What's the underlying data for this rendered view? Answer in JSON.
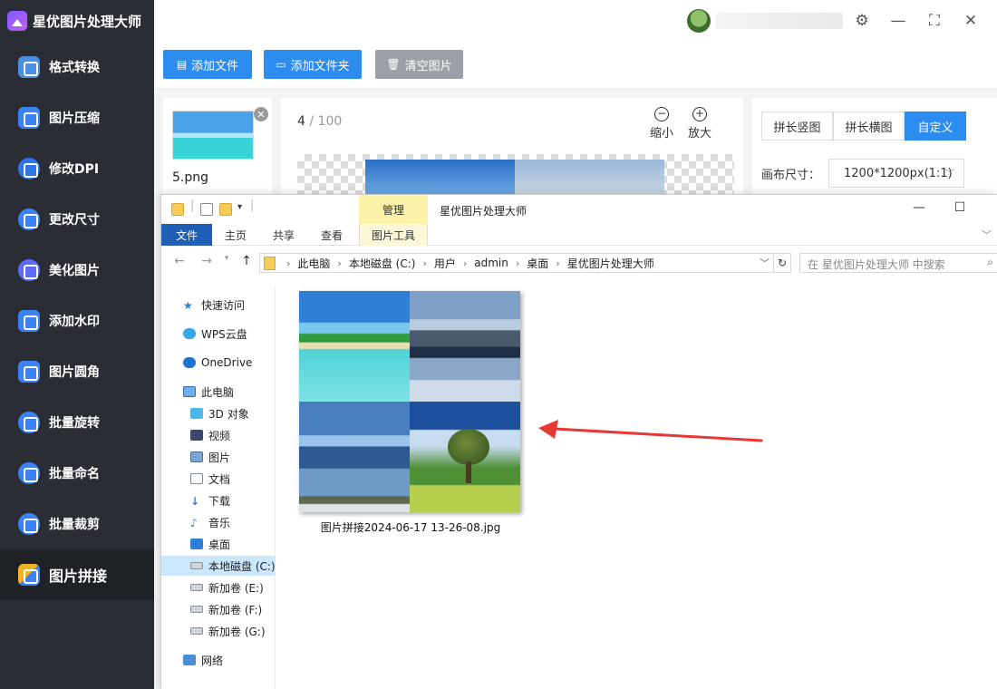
{
  "app": {
    "title": "星优图片处理大师",
    "nav": [
      {
        "label": "格式转换",
        "icon": "format-convert-icon",
        "color": "#4a90e2"
      },
      {
        "label": "图片压缩",
        "icon": "compress-icon",
        "color": "#3b82f6"
      },
      {
        "label": "修改DPI",
        "icon": "dpi-icon",
        "color": "#2f74e8"
      },
      {
        "label": "更改尺寸",
        "icon": "resize-icon",
        "color": "#3b82f6"
      },
      {
        "label": "美化图片",
        "icon": "beautify-icon",
        "color": "#5b6cff"
      },
      {
        "label": "添加水印",
        "icon": "watermark-icon",
        "color": "#3b82f6"
      },
      {
        "label": "图片圆角",
        "icon": "round-corner-icon",
        "color": "#3b82f6"
      },
      {
        "label": "批量旋转",
        "icon": "rotate-icon",
        "color": "#3b82f6"
      },
      {
        "label": "批量命名",
        "icon": "rename-icon",
        "color": "#3b82f6"
      },
      {
        "label": "批量裁剪",
        "icon": "crop-icon",
        "color": "#3b82f6"
      },
      {
        "label": "图片拼接",
        "icon": "stitch-icon",
        "color": "#f0b429",
        "active": true
      }
    ],
    "toolbar": {
      "add_file": "添加文件",
      "add_folder": "添加文件夹",
      "clear": "清空图片"
    },
    "thumbnail": {
      "name": "5.png"
    },
    "preview": {
      "current": "4",
      "separator": " / ",
      "total": "100",
      "zoom_out": "缩小",
      "zoom_in": "放大"
    },
    "modes": [
      "拼长竖图",
      "拼长横图",
      "自定义"
    ],
    "active_mode": "自定义",
    "canvas_label": "画布尺寸：",
    "canvas_value": "1200*1200px(1:1)",
    "colors": {
      "primary": "#2d8cf0",
      "sidebar": "#2a2d33",
      "clear_btn": "#9aa0a6"
    }
  },
  "explorer": {
    "title": "星优图片处理大师",
    "manage_tab": "管理",
    "ribbon_tabs": [
      "文件",
      "主页",
      "共享",
      "查看",
      "图片工具"
    ],
    "breadcrumbs": [
      "此电脑",
      "本地磁盘 (C:)",
      "用户",
      "admin",
      "桌面",
      "星优图片处理大师"
    ],
    "search_placeholder": "在 星优图片处理大师 中搜索",
    "nav_tree": [
      {
        "label": "快速访问",
        "icon": "star-icon"
      },
      {
        "label": "WPS云盘",
        "icon": "cloud-icon"
      },
      {
        "label": "OneDrive",
        "icon": "onedrive-icon"
      },
      {
        "label": "此电脑",
        "icon": "computer-icon"
      },
      {
        "label": "3D 对象",
        "icon": "cube-icon"
      },
      {
        "label": "视频",
        "icon": "video-icon"
      },
      {
        "label": "图片",
        "icon": "picture-icon"
      },
      {
        "label": "文档",
        "icon": "document-icon"
      },
      {
        "label": "下载",
        "icon": "download-icon"
      },
      {
        "label": "音乐",
        "icon": "music-icon"
      },
      {
        "label": "桌面",
        "icon": "desktop-icon"
      },
      {
        "label": "本地磁盘 (C:)",
        "icon": "drive-icon",
        "selected": true
      },
      {
        "label": "新加卷 (E:)",
        "icon": "drive-icon"
      },
      {
        "label": "新加卷 (F:)",
        "icon": "drive-icon"
      },
      {
        "label": "新加卷 (G:)",
        "icon": "drive-icon"
      },
      {
        "label": "网络",
        "icon": "network-icon"
      }
    ],
    "file": {
      "name": "图片拼接2024-06-17 13-26-08.jpg"
    }
  },
  "annotation": {
    "arrow_color": "#e53935"
  }
}
